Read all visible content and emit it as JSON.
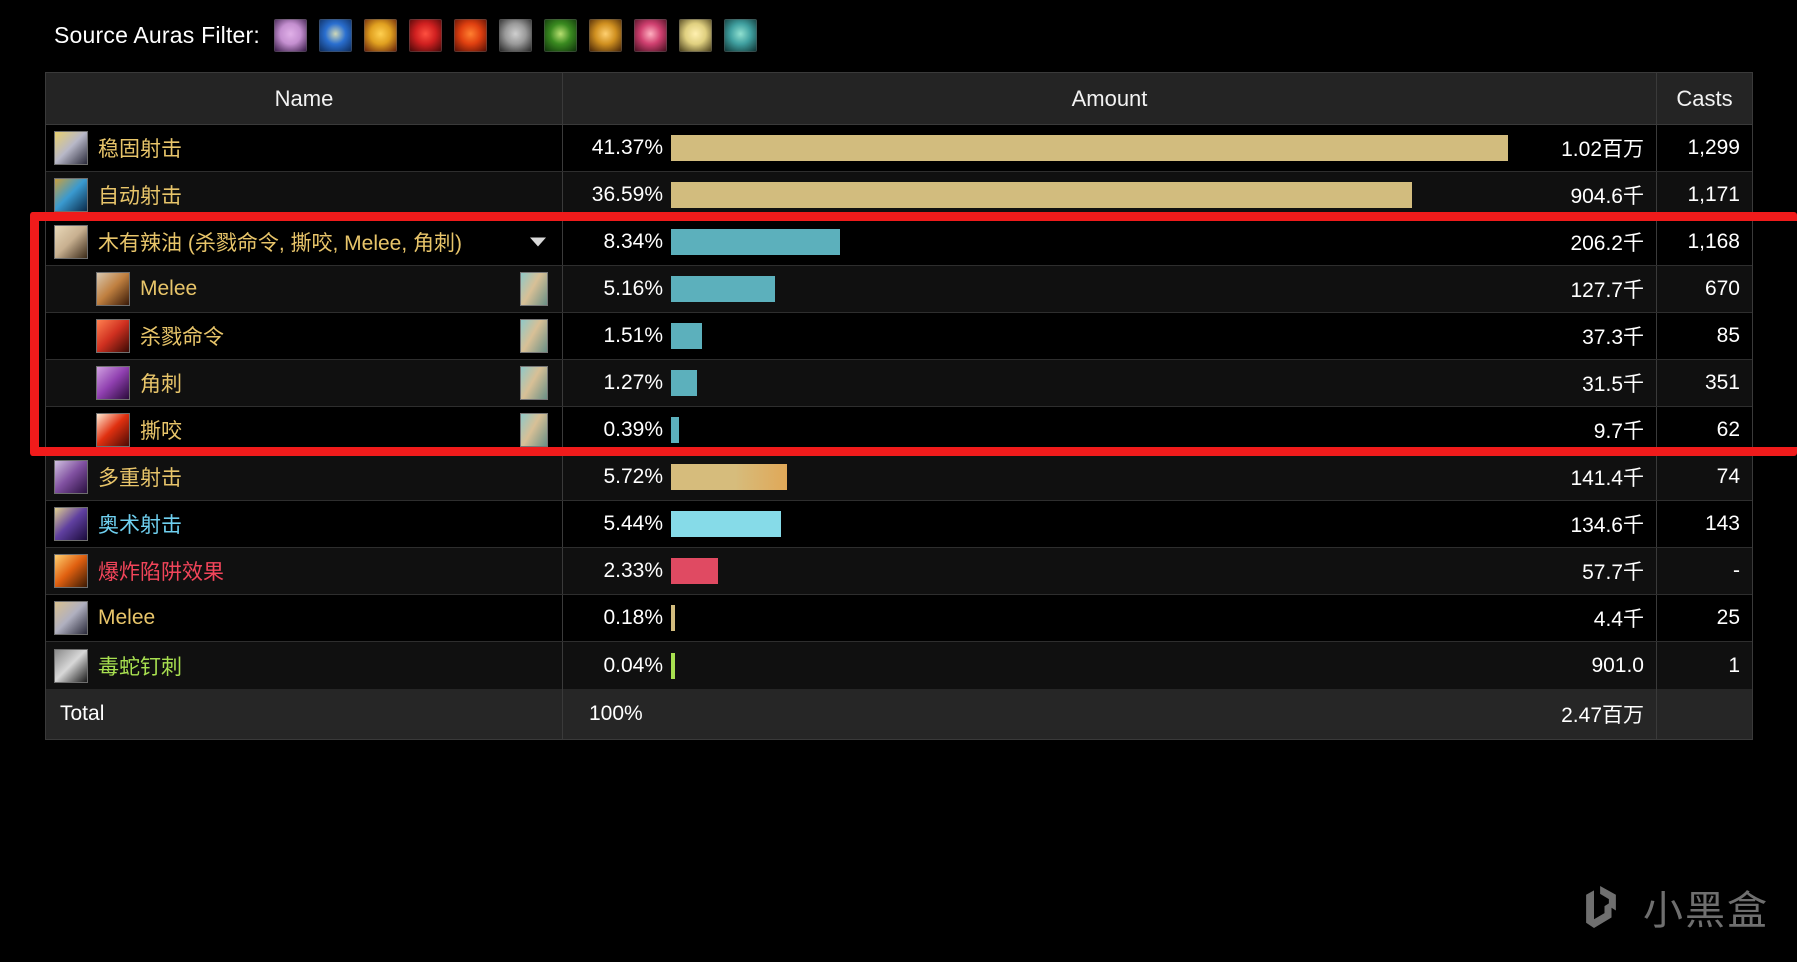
{
  "filter": {
    "label": "Source Auras Filter:",
    "icons": [
      {
        "name": "aura-icon-shadow-figure",
        "colors": [
          "#c48fd0",
          "#2a0f3a",
          "#e0b0e8"
        ]
      },
      {
        "name": "aura-icon-blue-arrow",
        "colors": [
          "#2a6fd0",
          "#0a2550",
          "#cfd8b8"
        ]
      },
      {
        "name": "aura-icon-orange-wings",
        "colors": [
          "#e0a020",
          "#5a1408",
          "#ffd050"
        ]
      },
      {
        "name": "aura-icon-red-figure",
        "colors": [
          "#d02020",
          "#3a0505",
          "#ff5040"
        ]
      },
      {
        "name": "aura-icon-red-fist",
        "colors": [
          "#e04010",
          "#4a0a04",
          "#ff8030"
        ]
      },
      {
        "name": "aura-icon-tankard",
        "colors": [
          "#9a9a9a",
          "#1a1a1a",
          "#cfcfcf"
        ]
      },
      {
        "name": "aura-icon-green-club",
        "colors": [
          "#3a8a20",
          "#0a2a08",
          "#b8e070"
        ]
      },
      {
        "name": "aura-icon-claw",
        "colors": [
          "#d09020",
          "#3a1a04",
          "#ffd070"
        ]
      },
      {
        "name": "aura-icon-pink-sword",
        "colors": [
          "#d04070",
          "#3a0a18",
          "#ffb0c0"
        ]
      },
      {
        "name": "aura-icon-yellow-bone",
        "colors": [
          "#e0d080",
          "#3a3010",
          "#fff0b0"
        ]
      },
      {
        "name": "aura-icon-teal-shard",
        "colors": [
          "#40a0a0",
          "#0a2a2a",
          "#90e0d0"
        ]
      }
    ]
  },
  "table": {
    "columns": {
      "name": "Name",
      "amount": "Amount",
      "casts": "Casts"
    },
    "rows": [
      {
        "name": "稳固射击",
        "name_color": "#e8c56a",
        "percent": "41.37%",
        "bar_pct": 41.37,
        "bar_color": "#d2bc7e",
        "amount": "1.02百万",
        "casts": "1,299",
        "level": 0,
        "expanded": false,
        "icon": "spell-icon-steady-shot",
        "icon_colors": [
          "#b8b8c8",
          "#2a2a3a",
          "#e8d070"
        ]
      },
      {
        "name": "自动射击",
        "name_color": "#e8c56a",
        "percent": "36.59%",
        "bar_pct": 36.59,
        "bar_color": "#d2bc7e",
        "amount": "904.6千",
        "casts": "1,171",
        "level": 0,
        "expanded": false,
        "icon": "spell-icon-auto-shot",
        "icon_colors": [
          "#3a9ad0",
          "#0a2a4a",
          "#c8a040"
        ]
      },
      {
        "name": "木有辣油 (杀戮命令, 撕咬, Melee, 角刺)",
        "name_color": "#e8c56a",
        "percent": "8.34%",
        "bar_pct": 8.34,
        "bar_color": "#5cb0bc",
        "amount": "206.2千",
        "casts": "1,168",
        "level": 0,
        "expanded": true,
        "icon": "spell-icon-whistle",
        "icon_colors": [
          "#c8b090",
          "#3a2a18",
          "#e8d8b8"
        ]
      },
      {
        "name": "Melee",
        "name_color": "#e8c56a",
        "percent": "5.16%",
        "bar_pct": 5.16,
        "bar_color": "#5cb0bc",
        "amount": "127.7千",
        "casts": "670",
        "level": 1,
        "expanded": false,
        "icon": "spell-icon-melee",
        "icon_colors": [
          "#c08040",
          "#3a1a08",
          "#d8c8b0"
        ],
        "source_icon": "source-icon-pet"
      },
      {
        "name": "杀戮命令",
        "name_color": "#e8c56a",
        "percent": "1.51%",
        "bar_pct": 1.51,
        "bar_color": "#5cb0bc",
        "amount": "37.3千",
        "casts": "85",
        "level": 1,
        "expanded": false,
        "icon": "spell-icon-kill-command",
        "icon_colors": [
          "#d03020",
          "#3a0a04",
          "#ff8050"
        ],
        "source_icon": "source-icon-pet"
      },
      {
        "name": "角刺",
        "name_color": "#e8c56a",
        "percent": "1.27%",
        "bar_pct": 1.27,
        "bar_color": "#5cb0bc",
        "amount": "31.5千",
        "casts": "351",
        "level": 1,
        "expanded": false,
        "icon": "spell-icon-gore",
        "icon_colors": [
          "#9040b0",
          "#2a0a3a",
          "#d0a0e0"
        ],
        "source_icon": "source-icon-pet"
      },
      {
        "name": "撕咬",
        "name_color": "#e8c56a",
        "percent": "0.39%",
        "bar_pct": 0.39,
        "bar_color": "#5cb0bc",
        "amount": "9.7千",
        "casts": "62",
        "level": 1,
        "expanded": false,
        "icon": "spell-icon-bite",
        "icon_colors": [
          "#e03010",
          "#4a0a04",
          "#ffe8d0"
        ],
        "source_icon": "source-icon-pet"
      },
      {
        "name": "多重射击",
        "name_color": "#e8c56a",
        "percent": "5.72%",
        "bar_pct": 5.72,
        "bar_color": "#d6bc7c",
        "amount": "141.4千",
        "casts": "74",
        "level": 0,
        "expanded": false,
        "icon": "spell-icon-multi-shot",
        "icon_colors": [
          "#8050a0",
          "#2a1040",
          "#d0c0e0"
        ]
      },
      {
        "name": "奥术射击",
        "name_color": "#6fd0f0",
        "percent": "5.44%",
        "bar_pct": 5.44,
        "bar_color": "#86dbe8",
        "amount": "134.6千",
        "casts": "143",
        "level": 0,
        "expanded": false,
        "icon": "spell-icon-arcane-shot",
        "icon_colors": [
          "#6040a0",
          "#1a0a3a",
          "#e0d090"
        ]
      },
      {
        "name": "爆炸陷阱效果",
        "name_color": "#f2455a",
        "percent": "2.33%",
        "bar_pct": 2.33,
        "bar_color": "#e04a62",
        "amount": "57.7千",
        "casts": "-",
        "level": 0,
        "expanded": false,
        "icon": "spell-icon-explosive-trap",
        "icon_colors": [
          "#e06010",
          "#3a1a04",
          "#ffd070"
        ]
      },
      {
        "name": "Melee",
        "name_color": "#e8c56a",
        "percent": "0.18%",
        "bar_pct": 0.18,
        "bar_color": "#d2bc7e",
        "amount": "4.4千",
        "casts": "25",
        "level": 0,
        "expanded": false,
        "icon": "spell-icon-melee",
        "icon_colors": [
          "#b0b0c0",
          "#2a2a3a",
          "#d8c090"
        ]
      },
      {
        "name": "毒蛇钉刺",
        "name_color": "#a8e050",
        "percent": "0.04%",
        "bar_pct": 0.04,
        "bar_color": "#a8e050",
        "amount": "901.0",
        "casts": "1",
        "level": 0,
        "expanded": false,
        "icon": "spell-icon-serpent-sting",
        "icon_colors": [
          "#d8d8d8",
          "#1a1a1a",
          "#8a8a8a"
        ]
      }
    ],
    "total": {
      "label": "Total",
      "percent": "100%",
      "amount": "2.47百万",
      "casts": ""
    }
  },
  "watermark": {
    "text": "小黑盒"
  }
}
